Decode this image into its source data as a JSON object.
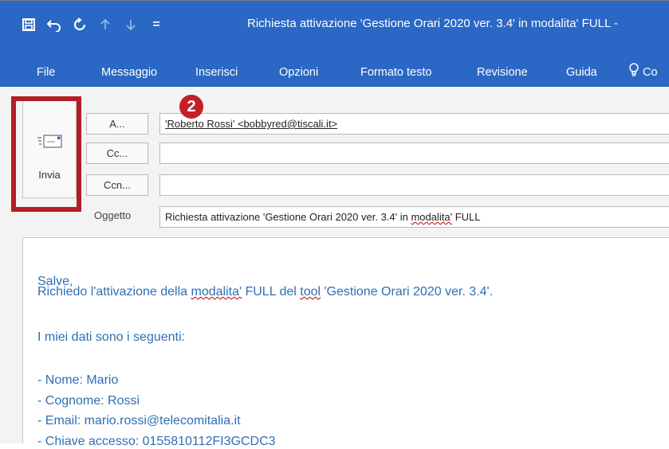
{
  "window": {
    "title": "Richiesta attivazione 'Gestione Orari 2020 ver. 3.4' in modalita' FULL  -"
  },
  "quick_access": [
    {
      "name": "save-icon"
    },
    {
      "name": "undo-icon"
    },
    {
      "name": "redo-icon"
    },
    {
      "name": "up-arrow-icon"
    },
    {
      "name": "down-arrow-icon"
    },
    {
      "name": "customize-qat-icon"
    }
  ],
  "menu": {
    "file": "File",
    "messaggio": "Messaggio",
    "inserisci": "Inserisci",
    "opzioni": "Opzioni",
    "formato_testo": "Formato testo",
    "revisione": "Revisione",
    "guida": "Guida",
    "tell_me": "Co"
  },
  "send": {
    "label": "Invia"
  },
  "fields": {
    "to_label": "A...",
    "to_value": "'Roberto Rossi' <bobbyred@tiscali.it>",
    "cc_label": "Cc...",
    "cc_value": "",
    "bcc_label": "Ccn...",
    "bcc_value": "",
    "subject_label": "Oggetto",
    "subject_prefix": "Richiesta attivazione 'Gestione Orari 2020 ver. 3.4' in ",
    "subject_misspelled": "modalita'",
    "subject_suffix": " FULL"
  },
  "badge": "2",
  "body": {
    "greeting": "Salve,",
    "line1_a": "Richiedo l'attivazione della ",
    "line1_b": "modalita'",
    "line1_c": " FULL del ",
    "line1_d": "tool",
    "line1_e": " 'Gestione Orari 2020 ver. 3.4'.",
    "line2": "I miei dati sono i seguenti:",
    "nome": "- Nome: Mario",
    "cognome": "- Cognome: Rossi",
    "email": "- Email: mario.rossi@telecomitalia.it",
    "chiave": "- Chiave accesso: 0155810112FI3GCDC3"
  },
  "colors": {
    "ribbon": "#2b67c4",
    "body_text": "#2f6eb5",
    "highlight": "#b21e24"
  }
}
